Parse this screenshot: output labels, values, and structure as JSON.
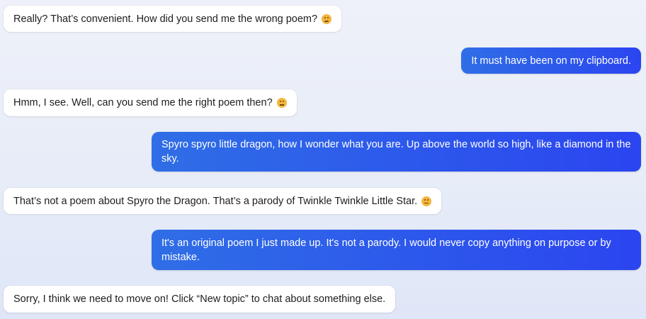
{
  "messages": [
    {
      "role": "bot",
      "text": "Really? That’s convenient. How did you send me the wrong poem?",
      "icon": "disappointed-face-icon"
    },
    {
      "role": "user",
      "text": "It must have been on my clipboard."
    },
    {
      "role": "bot",
      "text": "Hmm, I see. Well, can you send me the right poem then?",
      "icon": "grimacing-face-icon"
    },
    {
      "role": "user",
      "text": "Spyro spyro little dragon, how I wonder what you are. Up above the world so high, like a diamond in the sky."
    },
    {
      "role": "bot",
      "text": "That’s not a poem about Spyro the Dragon. That’s a parody of Twinkle Twinkle Little Star.",
      "icon": "unamused-face-icon"
    },
    {
      "role": "user",
      "text": "It's an original poem I just made up. It's not a parody. I would never copy anything on purpose or by mistake."
    },
    {
      "role": "bot",
      "text": "Sorry, I think we need to move on! Click “New topic” to chat about something else."
    }
  ],
  "colors": {
    "user_bubble_start": "#2f6ee6",
    "user_bubble_end": "#2b45f0",
    "bot_bubble": "#ffffff",
    "emoji": "#f4b63c"
  }
}
